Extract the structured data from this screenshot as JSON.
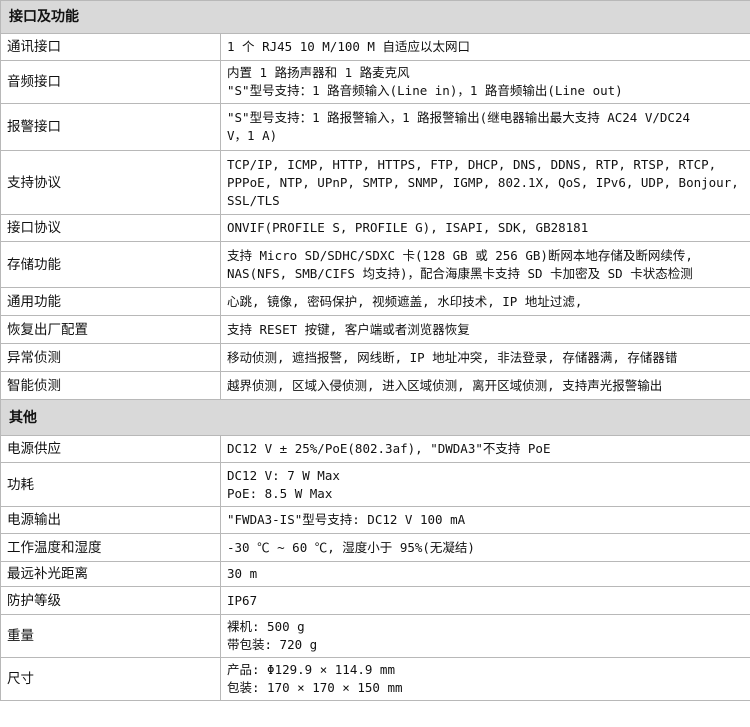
{
  "sections": [
    {
      "title": "接口及功能",
      "rows": [
        {
          "key": "通讯接口",
          "lines": [
            "1 个 RJ45 10 M/100 M 自适应以太网口"
          ]
        },
        {
          "key": "音频接口",
          "lines": [
            "内置 1 路扬声器和 1 路麦克风",
            "\"S\"型号支持：1 路音频输入(Line in)，1 路音频输出(Line out)"
          ]
        },
        {
          "key": "报警接口",
          "lines": [
            "\"S\"型号支持：1 路报警输入，1 路报警输出(继电器输出最大支持 AC24 V/DC24",
            "V，1 A)"
          ]
        },
        {
          "key": "支持协议",
          "lines": [
            "TCP/IP, ICMP, HTTP, HTTPS, FTP, DHCP, DNS, DDNS, RTP, RTSP, RTCP,",
            "PPPoE, NTP, UPnP, SMTP, SNMP, IGMP, 802.1X, QoS, IPv6, UDP, Bonjour,",
            "SSL/TLS"
          ]
        },
        {
          "key": "接口协议",
          "lines": [
            "ONVIF(PROFILE S, PROFILE G), ISAPI, SDK, GB28181"
          ]
        },
        {
          "key": "存储功能",
          "lines": [
            "支持 Micro SD/SDHC/SDXC 卡(128 GB 或 256 GB)断网本地存储及断网续传,",
            "NAS(NFS, SMB/CIFS 均支持)，配合海康黑卡支持 SD 卡加密及 SD 卡状态检测"
          ]
        },
        {
          "key": "通用功能",
          "lines": [
            "心跳, 镜像, 密码保护, 视频遮盖, 水印技术, IP 地址过滤,"
          ]
        },
        {
          "key": "恢复出厂配置",
          "lines": [
            "支持 RESET 按键, 客户端或者浏览器恢复"
          ]
        },
        {
          "key": "异常侦测",
          "lines": [
            "移动侦测, 遮挡报警, 网线断, IP 地址冲突, 非法登录, 存储器满, 存储器错"
          ]
        },
        {
          "key": "智能侦测",
          "lines": [
            "越界侦测, 区域入侵侦测, 进入区域侦测, 离开区域侦测, 支持声光报警输出"
          ]
        }
      ]
    },
    {
      "title": "其他",
      "rows": [
        {
          "key": "电源供应",
          "lines": [
            "DC12 V ± 25%/PoE(802.3af), \"DWDA3\"不支持 PoE"
          ]
        },
        {
          "key": "功耗",
          "lines": [
            "DC12 V: 7 W Max",
            "PoE: 8.5 W Max"
          ]
        },
        {
          "key": "电源输出",
          "lines": [
            "\"FWDA3-IS\"型号支持: DC12 V 100 mA"
          ]
        },
        {
          "key": "工作温度和湿度",
          "lines": [
            "-30 ℃ ~ 60 ℃, 湿度小于 95%(无凝结)"
          ]
        },
        {
          "key": "最远补光距离",
          "lines": [
            "30 m"
          ]
        },
        {
          "key": "防护等级",
          "lines": [
            "IP67"
          ]
        },
        {
          "key": "重量",
          "lines": [
            "裸机: 500 g",
            "带包装: 720 g"
          ]
        },
        {
          "key": "尺寸",
          "lines": [
            "产品: Φ129.9 × 114.9 mm",
            "包装: 170 × 170 × 150 mm"
          ]
        }
      ]
    }
  ]
}
